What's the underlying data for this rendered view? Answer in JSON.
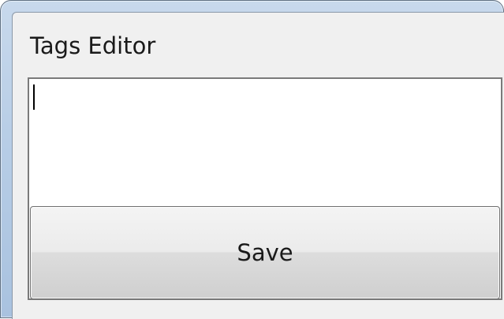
{
  "window": {
    "title": "Tags Editor"
  },
  "tags_input": {
    "value": ""
  },
  "save_button": {
    "label": "Save"
  }
}
